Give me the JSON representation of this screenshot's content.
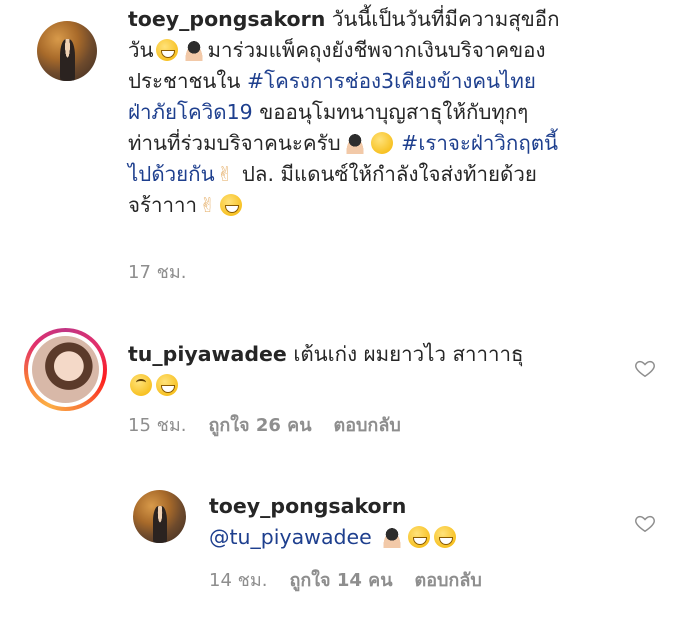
{
  "comment1": {
    "username": "toey_pongsakorn",
    "line1_text": "วันนี้เป็นวันที่มีความสุขอีก",
    "line2_start": "วัน",
    "line2_end": "มาร่วมแพ็คถุงยังชีพจากเงินบริจาคของ",
    "line3_start": "ประชาชนใน ",
    "hashtag1_line3": "#โครงการช่อง3เคียงข้างคนไทย",
    "hashtag1_line4": "ฝ่าภัยโควิด19",
    "line4_end": " ขออนุโมทนาบุญสาธุให้กับทุกๆ",
    "line5_start": "ท่านที่ร่วมบริจาคนะครับ",
    "hashtag2_line5": "#เราจะฝ่าวิกฤตนี้",
    "hashtag2_line6": "ไปด้วยกัน",
    "line6_end": " ปล. มีแดนซ์ให้กำลังใจส่งท้ายด้วย",
    "line7": "จร้าาาา",
    "time": "17 ชม."
  },
  "comment2": {
    "username": "tu_piyawadee",
    "text": "เต้นเก่ง ผมยาวไว สาาาาธุ",
    "time": "15 ชม.",
    "likes": "ถูกใจ 26 คน",
    "reply": "ตอบกลับ"
  },
  "comment3": {
    "username": "toey_pongsakorn",
    "mention": "@tu_piyawadee",
    "time": "14 ชม.",
    "likes": "ถูกใจ 14 คน",
    "reply": "ตอบกลับ"
  },
  "icons": {
    "heart_color": "#8e8e8e",
    "hashtag_color": "#1e3f8e",
    "story_ring": [
      "#c13584",
      "#e1306c",
      "#fd1d1d",
      "#f77737",
      "#fcaf45"
    ]
  }
}
